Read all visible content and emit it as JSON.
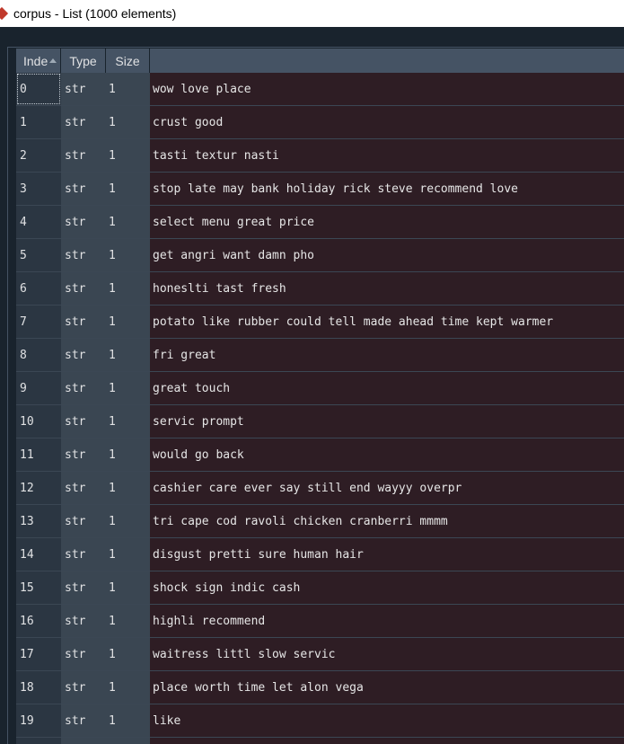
{
  "window": {
    "title": "corpus - List (1000 elements)"
  },
  "colors": {
    "value_bg": "#2e1d24",
    "header_bg": "#455364",
    "index_bg": "#2b3642",
    "type_bg": "#3a4652"
  },
  "table": {
    "columns": {
      "index": "Inde",
      "type": "Type",
      "size": "Size"
    },
    "rows": [
      {
        "index": "0",
        "type": "str",
        "size": "1",
        "value": "wow love place"
      },
      {
        "index": "1",
        "type": "str",
        "size": "1",
        "value": "crust good"
      },
      {
        "index": "2",
        "type": "str",
        "size": "1",
        "value": "tasti textur nasti"
      },
      {
        "index": "3",
        "type": "str",
        "size": "1",
        "value": "stop late may bank holiday rick steve recommend love"
      },
      {
        "index": "4",
        "type": "str",
        "size": "1",
        "value": "select menu great price"
      },
      {
        "index": "5",
        "type": "str",
        "size": "1",
        "value": "get angri want damn pho"
      },
      {
        "index": "6",
        "type": "str",
        "size": "1",
        "value": "honeslti tast fresh"
      },
      {
        "index": "7",
        "type": "str",
        "size": "1",
        "value": "potato like rubber could tell made ahead time kept warmer"
      },
      {
        "index": "8",
        "type": "str",
        "size": "1",
        "value": "fri great"
      },
      {
        "index": "9",
        "type": "str",
        "size": "1",
        "value": "great touch"
      },
      {
        "index": "10",
        "type": "str",
        "size": "1",
        "value": "servic prompt"
      },
      {
        "index": "11",
        "type": "str",
        "size": "1",
        "value": "would go back"
      },
      {
        "index": "12",
        "type": "str",
        "size": "1",
        "value": "cashier care ever say still end wayyy overpr"
      },
      {
        "index": "13",
        "type": "str",
        "size": "1",
        "value": "tri cape cod ravoli chicken cranberri mmmm"
      },
      {
        "index": "14",
        "type": "str",
        "size": "1",
        "value": "disgust pretti sure human hair"
      },
      {
        "index": "15",
        "type": "str",
        "size": "1",
        "value": "shock sign indic cash"
      },
      {
        "index": "16",
        "type": "str",
        "size": "1",
        "value": "highli recommend"
      },
      {
        "index": "17",
        "type": "str",
        "size": "1",
        "value": "waitress littl slow servic"
      },
      {
        "index": "18",
        "type": "str",
        "size": "1",
        "value": "place worth time let alon vega"
      },
      {
        "index": "19",
        "type": "str",
        "size": "1",
        "value": "like"
      },
      {
        "index": "",
        "type": "",
        "size": "",
        "value": ""
      }
    ]
  }
}
